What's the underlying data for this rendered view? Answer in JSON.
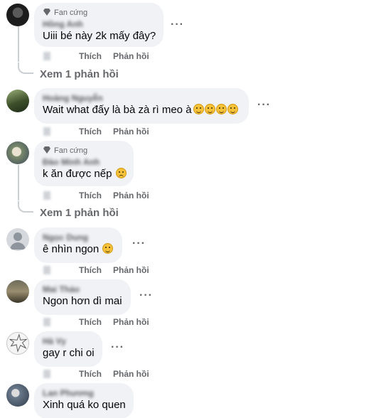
{
  "badge_label": "Fan cứng",
  "reply_action": "Phản hồi",
  "like_action": "Thích",
  "comments": [
    {
      "name": "Hồng Anh",
      "has_badge": true,
      "text": "Uiii bé này 2k mấy đây?",
      "emoji_count": 0
    },
    {
      "name": "Hoàng Nguyễn",
      "has_badge": false,
      "text": "Wait what đấy là bà zà rì meo à",
      "emoji_count": 4
    },
    {
      "name": "Đào Minh Anh",
      "has_badge": true,
      "text": "k ăn được nếp",
      "emoji_count": 1
    },
    {
      "name": "Ngọc Dung",
      "has_badge": false,
      "text": "ê nhìn ngon",
      "emoji_count": 1
    },
    {
      "name": "Mai Thảo",
      "has_badge": false,
      "text": "Ngon hơn dì mai",
      "emoji_count": 0
    },
    {
      "name": "Hà Vy",
      "has_badge": false,
      "text": "gay r chi oi",
      "emoji_count": 0
    },
    {
      "name": "Lan Phương",
      "has_badge": false,
      "text": "Xinh quá ko quen",
      "emoji_count": 0
    }
  ],
  "view_replies": [
    "Xem 1 phản hồi",
    "Xem 1 phản hồi"
  ],
  "colors": {
    "bubble": "#f0f2f5",
    "secondary_text": "#65676b",
    "primary_text": "#050505",
    "thread_line": "#ccd0d5"
  },
  "icons": {
    "badge": "diamond-icon",
    "more": "more-options-icon",
    "emoji": "smiling-face-emoji"
  }
}
